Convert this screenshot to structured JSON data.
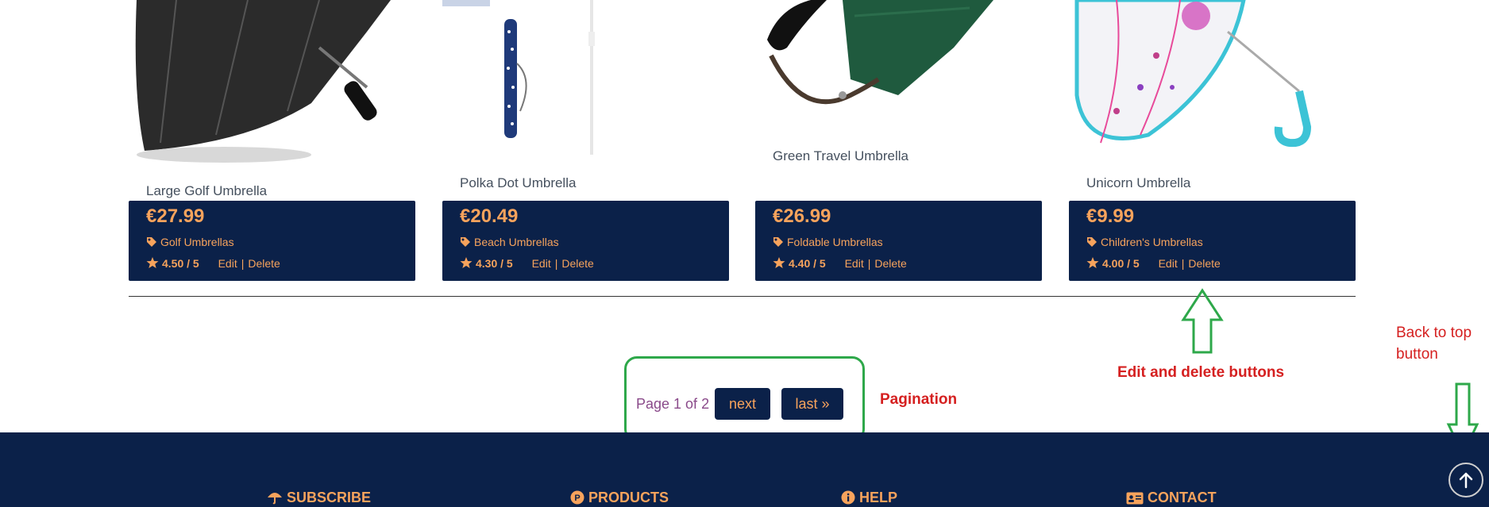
{
  "products": [
    {
      "name": "Large Golf Umbrella",
      "price": "€27.99",
      "category": "Golf Umbrellas",
      "rating": "4.50 / 5",
      "edit": "Edit",
      "delete": "Delete"
    },
    {
      "name": "Polka Dot Umbrella",
      "price": "€20.49",
      "category": "Beach Umbrellas",
      "rating": "4.30 / 5",
      "edit": "Edit",
      "delete": "Delete"
    },
    {
      "name": "Green Travel Umbrella",
      "price": "€26.99",
      "category": "Foldable Umbrellas",
      "rating": "4.40 / 5",
      "edit": "Edit",
      "delete": "Delete"
    },
    {
      "name": "Unicorn Umbrella",
      "price": "€9.99",
      "category": "Children's Umbrellas",
      "rating": "4.00 / 5",
      "edit": "Edit",
      "delete": "Delete"
    }
  ],
  "pagination": {
    "info": "Page 1 of 2",
    "next": "next",
    "last": "last »"
  },
  "annotations": {
    "pagination": "Pagination",
    "edit_delete": "Edit and delete buttons",
    "back_to_top_line1": "Back to top",
    "back_to_top_line2": "button"
  },
  "footer": {
    "subscribe": "SUBSCRIBE",
    "products": "PRODUCTS",
    "help": "HELP",
    "contact": "CONTACT"
  },
  "colors": {
    "navy": "#0b2149",
    "accent": "#f7a35c",
    "annotation_green": "#2ea84a",
    "annotation_red": "#d52020"
  }
}
